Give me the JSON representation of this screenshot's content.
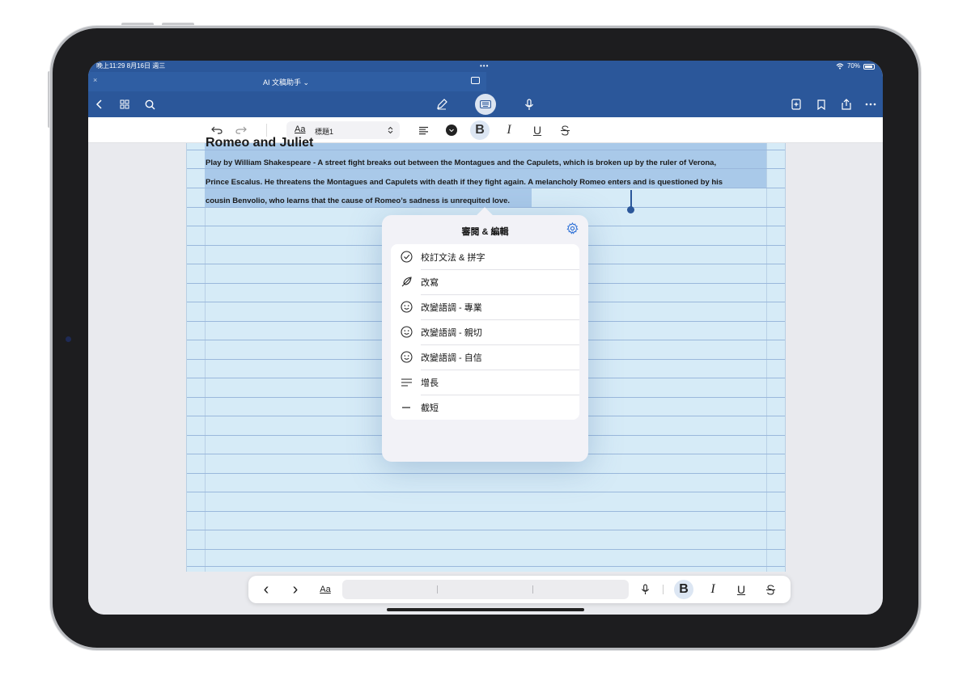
{
  "status_bar": {
    "time_date": "晚上11:29  8月16日 週三",
    "dots": "•••",
    "battery": "70%"
  },
  "tab": {
    "close": "×",
    "title": "AI 文稿助手 ⌄"
  },
  "format_bar": {
    "style_sample": "Aa",
    "style_name": "標題1",
    "bold": "B",
    "italic": "I",
    "underline": "U"
  },
  "document": {
    "title": "Romeo and Juliet",
    "lines": [
      "Play by William Shakespeare - A street fight breaks out between the Montagues and the Capulets, which is broken up by the ruler of Verona,",
      "Prince Escalus. He threatens the Montagues and Capulets with death if they fight again. A melancholy Romeo enters and is questioned by his",
      "cousin Benvolio, who learns that the cause of Romeo’s sadness is unrequited love."
    ]
  },
  "popup": {
    "title": "審閱 & 編輯",
    "items": [
      {
        "label": "校訂文法 & 拼字",
        "icon": "checkmark-circle-icon"
      },
      {
        "label": "改寫",
        "icon": "feather-icon"
      },
      {
        "label": "改變語調 - 專業",
        "icon": "smiley-icon"
      },
      {
        "label": "改變語調 - 親切",
        "icon": "smiley-icon"
      },
      {
        "label": "改變語調 - 自信",
        "icon": "smiley-icon"
      },
      {
        "label": "增長",
        "icon": "lines-icon"
      },
      {
        "label": "截短",
        "icon": "dash-icon"
      }
    ]
  },
  "bottom_bar": {
    "prev": "‹",
    "next": "›",
    "text_style": "Aa",
    "bold": "B",
    "italic": "I",
    "underline": "U"
  },
  "colors": {
    "accent": "#2b579a",
    "paper": "#d6ebf7",
    "selection": "#a9c9e9"
  }
}
